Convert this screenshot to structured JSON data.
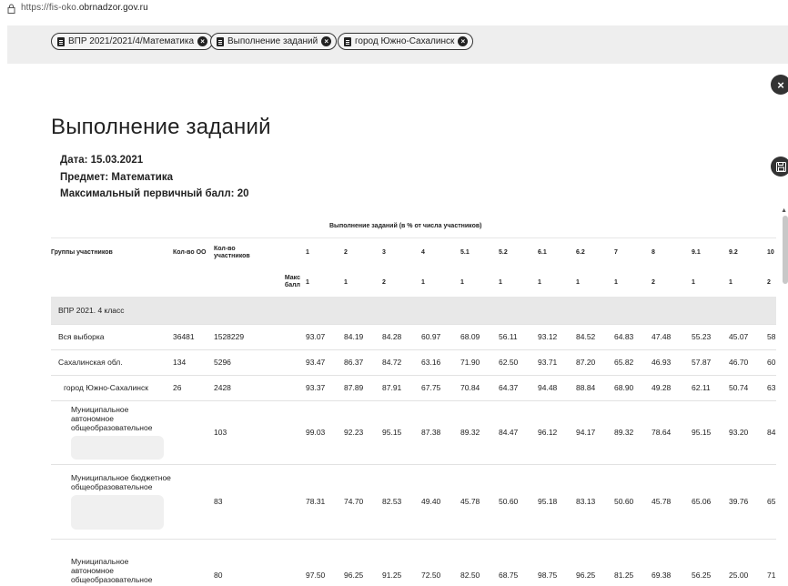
{
  "browser": {
    "url_prefix": "https://fis-oko.",
    "url_host": "obrnadzor.gov.ru"
  },
  "filters": [
    {
      "label": "ВПР 2021/2021/4/Математика"
    },
    {
      "label": "Выполнение заданий"
    },
    {
      "label": "город Южно-Сахалинск"
    }
  ],
  "buttons": {
    "close_icon": "×",
    "save_icon": "floppy-disk-icon"
  },
  "page": {
    "title": "Выполнение заданий",
    "date": "Дата: 15.03.2021",
    "subject": "Предмет: Математика",
    "max_score": "Максимальный первичный балл: 20"
  },
  "table": {
    "super_header": "Выполнение заданий (в % от числа участников)",
    "col_groups": "Группы участников",
    "col_oo": "Кол-во ОО",
    "col_participants": "Кол-во участников",
    "max_label": "Макс балл",
    "tasks": [
      "1",
      "2",
      "3",
      "4",
      "5.1",
      "5.2",
      "6.1",
      "6.2",
      "7",
      "8",
      "9.1",
      "9.2",
      "10"
    ],
    "max_scores": [
      "1",
      "1",
      "2",
      "1",
      "1",
      "1",
      "1",
      "1",
      "1",
      "2",
      "1",
      "1",
      "2"
    ],
    "section": "ВПР 2021. 4 класс",
    "rows": [
      {
        "name": "Вся выборка",
        "oo": "36481",
        "n": "1528229",
        "v": [
          "93.07",
          "84.19",
          "84.28",
          "60.97",
          "68.09",
          "56.11",
          "93.12",
          "84.52",
          "64.83",
          "47.48",
          "55.23",
          "45.07",
          "58"
        ]
      },
      {
        "name": "Сахалинская обл.",
        "oo": "134",
        "n": "5296",
        "v": [
          "93.47",
          "86.37",
          "84.72",
          "63.16",
          "71.90",
          "62.50",
          "93.71",
          "87.20",
          "65.82",
          "46.93",
          "57.87",
          "46.70",
          "60"
        ]
      },
      {
        "name": "город Южно-Сахалинск",
        "oo": "26",
        "n": "2428",
        "v": [
          "93.37",
          "87.89",
          "87.91",
          "67.75",
          "70.84",
          "64.37",
          "94.48",
          "88.84",
          "68.90",
          "49.28",
          "62.11",
          "50.74",
          "63"
        ]
      },
      {
        "name": "Муниципальное автономное общеобразовательное",
        "oo": "",
        "n": "103",
        "v": [
          "99.03",
          "92.23",
          "95.15",
          "87.38",
          "89.32",
          "84.47",
          "96.12",
          "94.17",
          "89.32",
          "78.64",
          "95.15",
          "93.20",
          "84"
        ]
      },
      {
        "name": "Муниципальное бюджетное общеобразовательное",
        "oo": "",
        "n": "83",
        "v": [
          "78.31",
          "74.70",
          "82.53",
          "49.40",
          "45.78",
          "50.60",
          "95.18",
          "83.13",
          "50.60",
          "45.78",
          "65.06",
          "39.76",
          "65"
        ]
      },
      {
        "name": "Муниципальное автономное общеобразовательное учреждение",
        "oo": "",
        "n": "80",
        "v": [
          "97.50",
          "96.25",
          "91.25",
          "72.50",
          "82.50",
          "68.75",
          "98.75",
          "96.25",
          "81.25",
          "69.38",
          "56.25",
          "25.00",
          "71"
        ]
      }
    ]
  }
}
